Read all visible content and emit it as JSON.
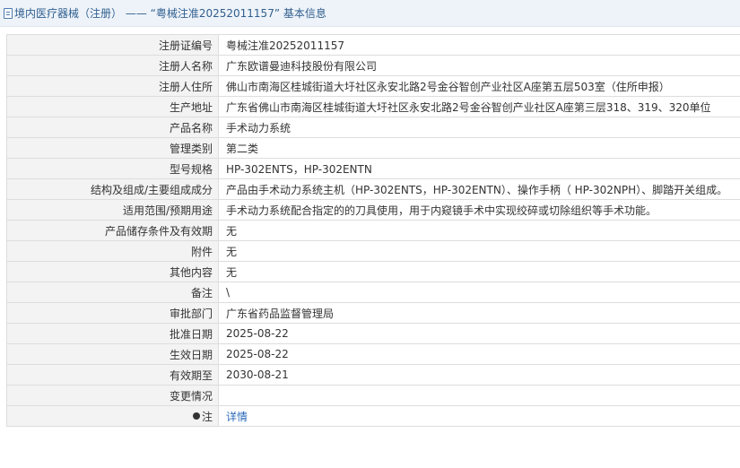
{
  "header": {
    "title": "境内医疗器械（注册） —— “粤械注准20252011157” 基本信息"
  },
  "rows": [
    {
      "label": "注册证编号",
      "value": "粤械注准20252011157"
    },
    {
      "label": "注册人名称",
      "value": "广东欧谱曼迪科技股份有限公司"
    },
    {
      "label": "注册人住所",
      "value": "佛山市南海区桂城街道大圩社区永安北路2号金谷智创产业社区A座第五层503室（住所申报）"
    },
    {
      "label": "生产地址",
      "value": "广东省佛山市南海区桂城街道大圩社区永安北路2号金谷智创产业社区A座第三层318、319、320单位"
    },
    {
      "label": "产品名称",
      "value": "手术动力系统"
    },
    {
      "label": "管理类别",
      "value": "第二类"
    },
    {
      "label": "型号规格",
      "value": "HP-302ENTS，HP-302ENTN"
    },
    {
      "label": "结构及组成/主要组成成分",
      "value": "产品由手术动力系统主机（HP-302ENTS，HP-302ENTN）、操作手柄（ HP-302NPH）、脚踏开关组成。"
    },
    {
      "label": "适用范围/预期用途",
      "value": "手术动力系统配合指定的的刀具使用，用于内窥镜手术中实现绞碎或切除组织等手术功能。"
    },
    {
      "label": "产品储存条件及有效期",
      "value": "无"
    },
    {
      "label": "附件",
      "value": "无"
    },
    {
      "label": "其他内容",
      "value": "无"
    },
    {
      "label": "备注",
      "value": "\\"
    },
    {
      "label": "审批部门",
      "value": "广东省药品监督管理局"
    },
    {
      "label": "批准日期",
      "value": "2025-08-22"
    },
    {
      "label": "生效日期",
      "value": "2025-08-22"
    },
    {
      "label": "有效期至",
      "value": "2030-08-21"
    },
    {
      "label": "变更情况",
      "value": ""
    }
  ],
  "note_row": {
    "label": "注",
    "icon": "bulb-icon",
    "link_text": "详情"
  }
}
